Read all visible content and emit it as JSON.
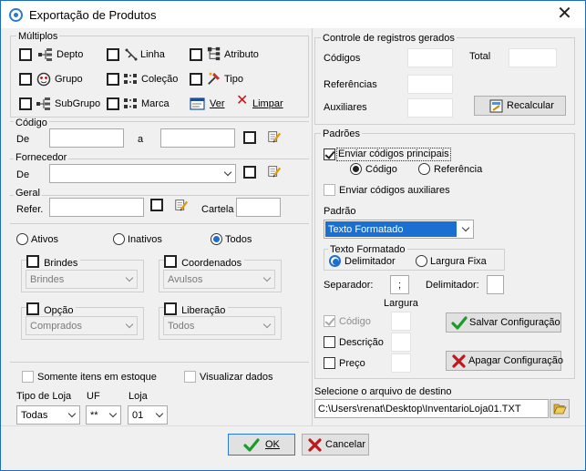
{
  "window": {
    "title": "Exportação de Produtos",
    "close_glyph": "✕"
  },
  "multiplos": {
    "label": "Múltiplos",
    "items": [
      {
        "label": "Depto",
        "icon": "tree-icon"
      },
      {
        "label": "Linha",
        "icon": "link-icon"
      },
      {
        "label": "Atributo",
        "icon": "hierarchy-icon"
      },
      {
        "label": "Grupo",
        "icon": "face-icon"
      },
      {
        "label": "Coleção",
        "icon": "dots-grid-icon"
      },
      {
        "label": "Tipo",
        "icon": "tools-icon"
      },
      {
        "label": "SubGrupo",
        "icon": "tree-icon"
      },
      {
        "label": "Marca",
        "icon": "dots-grid-icon"
      }
    ],
    "ver_label": "Ver",
    "limpar_label": "Limpar"
  },
  "codigo": {
    "label": "Código",
    "de_label": "De",
    "a_label": "a",
    "de_value": "",
    "a_value": ""
  },
  "fornecedor": {
    "label": "Fornecedor",
    "de_label": "De",
    "value": ""
  },
  "geral": {
    "label": "Geral",
    "refer_label": "Refer.",
    "refer_value": "",
    "cartela_label": "Cartela",
    "cartela_value": ""
  },
  "status": {
    "ativos": "Ativos",
    "inativos": "Inativos",
    "todos": "Todos",
    "selected": "Todos"
  },
  "brindes": {
    "label": "Brindes",
    "value": "Brindes"
  },
  "coordenados": {
    "label": "Coordenados",
    "value": "Avulsos"
  },
  "opcao": {
    "label": "Opção",
    "value": "Comprados"
  },
  "liberacao": {
    "label": "Liberação",
    "value": "Todos"
  },
  "filters": {
    "somente_estoque": "Somente itens em estoque",
    "visualizar_dados": "Visualizar dados",
    "tipo_loja_label": "Tipo de Loja",
    "tipo_loja_value": "Todas",
    "uf_label": "UF",
    "uf_value": "**",
    "loja_label": "Loja",
    "loja_value": "01"
  },
  "controle": {
    "label": "Controle de registros gerados",
    "codigos": "Códigos",
    "total": "Total",
    "referencias": "Referências",
    "auxiliares": "Auxiliares",
    "recalcular": "Recalcular"
  },
  "padroes": {
    "label": "Padrões",
    "enviar_principais": "Enviar códigos principais",
    "codigo": "Código",
    "referencia": "Referência",
    "enviar_auxiliares": "Enviar códigos auxiliares",
    "padrao_label": "Padrão",
    "padrao_value": "Texto Formatado",
    "texto_formatado_label": "Texto Formatado",
    "delimitador": "Delimitador",
    "largura_fixa": "Largura Fixa",
    "separador_label": "Separador:",
    "separador_value": ";",
    "delimitador_label": "Delimitador:",
    "delimitador_value": "",
    "largura_label": "Largura",
    "codigo_cb": "Código",
    "descricao_cb": "Descrição",
    "preco_cb": "Preço",
    "salvar": "Salvar Configuração",
    "apagar": "Apagar Configuração"
  },
  "destino": {
    "label": "Selecione o arquivo de destino",
    "path": "C:\\Users\\renat\\Desktop\\InventarioLoja01.TXT"
  },
  "footer": {
    "ok": "OK",
    "cancelar": "Cancelar"
  },
  "colors": {
    "accent": "#1a6fd0",
    "ok_green": "#1e9a2b",
    "cancel_red": "#c4161c"
  }
}
